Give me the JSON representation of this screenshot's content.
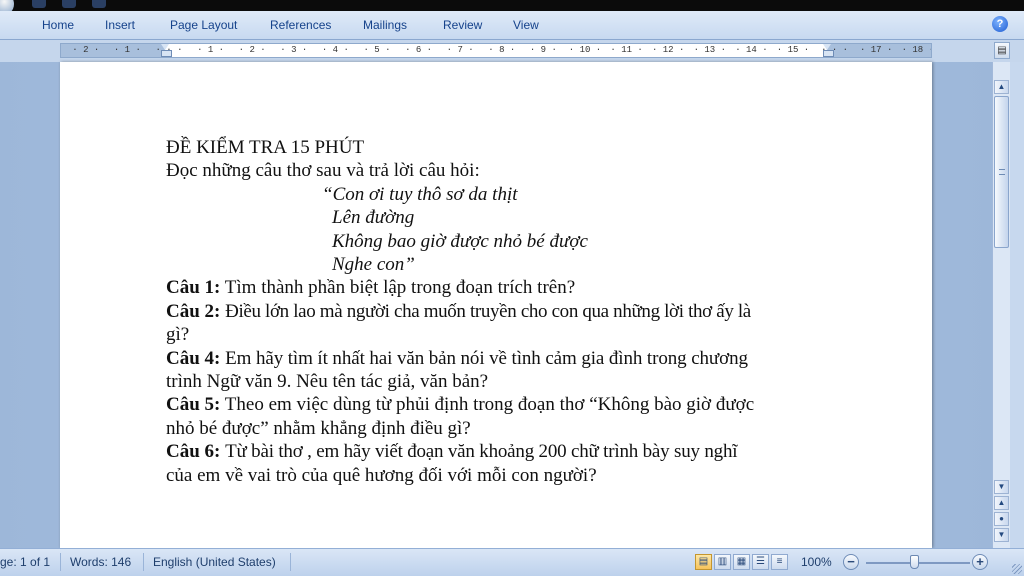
{
  "ribbon": {
    "tabs": [
      "Home",
      "Insert",
      "Page Layout",
      "References",
      "Mailings",
      "Review",
      "View"
    ]
  },
  "ruler": {
    "marks": [
      "2",
      "1",
      "",
      "1",
      "2",
      "3",
      "4",
      "5",
      "6",
      "7",
      "8",
      "9",
      "10",
      "11",
      "12",
      "13",
      "14",
      "15",
      "",
      "17",
      "18"
    ]
  },
  "document": {
    "title": "ĐỀ KIỂM TRA 15 PHÚT",
    "instruction": "Đọc những câu thơ sau và trả lời câu hỏi:",
    "poem": [
      "“Con ơi tuy thô sơ da thịt",
      "Lên đường",
      "Không bao giờ được nhỏ bé được",
      "Nghe con”"
    ],
    "questions": [
      {
        "label": "Câu 1:",
        "lines": [
          "Tìm thành phần biệt lập trong đoạn trích trên?"
        ]
      },
      {
        "label": "Câu 2:",
        "lines": [
          "Điều lớn lao mà người cha muốn truyền cho con qua những lời thơ ấy là",
          "gì?"
        ]
      },
      {
        "label": "Câu 4:",
        "lines": [
          "Em hãy tìm ít nhất hai văn bản nói về tình cảm gia đình trong chương",
          "trình Ngữ văn 9. Nêu tên tác giả, văn bản?"
        ]
      },
      {
        "label": "Câu 5:",
        "lines": [
          "Theo em việc dùng từ phủi định trong đoạn thơ “Không bào giờ được",
          "nhỏ bé được” nhằm khẳng định điều gì?"
        ]
      },
      {
        "label": "Câu 6:",
        "lines": [
          "Từ bài thơ , em hãy viết đoạn văn khoảng 200 chữ trình bày suy nghĩ",
          "của em về vai trò của quê hương đối với mỗi con người?"
        ]
      }
    ]
  },
  "status": {
    "page": "ge: 1 of 1",
    "words": "Words: 146",
    "language": "English (United States)",
    "zoom": "100%",
    "zoom_minus": "−",
    "zoom_plus": "+"
  },
  "icons": {
    "help": "?",
    "scroll_up": "▲",
    "scroll_down": "▼",
    "prev_page": "▲",
    "select_browse": "●",
    "next_page": "▼"
  },
  "colors": {
    "ribbon_text": "#15428b",
    "accent_active": "#f7c35b"
  }
}
